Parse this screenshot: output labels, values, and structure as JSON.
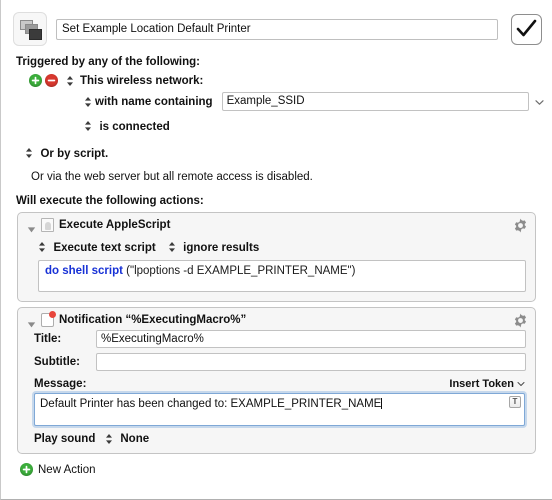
{
  "window": {
    "macro_icon": "macro-stack-icon",
    "title_value": "Set Example Location Default Printer",
    "confirm_icon": "checkmark-icon"
  },
  "triggers": {
    "heading": "Triggered by any of the following:",
    "add_icon": "plus-circle-icon",
    "remove_icon": "minus-circle-icon",
    "trigger_type": "This wireless network:",
    "condition_label": "with name containing",
    "ssid_value": "Example_SSID",
    "ssid_dropdown_icon": "chevron-down-icon",
    "state_label": "is connected",
    "or_by_script": "Or by script.",
    "web_server_note": "Or via the web server but all remote access is disabled."
  },
  "actions": {
    "heading": "Will execute the following actions:",
    "list": [
      {
        "disclosure_icon": "disclosure-triangle-down-icon",
        "icon": "applescript-icon",
        "title": "Execute AppleScript",
        "gear_icon": "gear-icon",
        "option_execute": "Execute text script",
        "option_results": "ignore results",
        "script_keyword": "do shell script",
        "script_rest": " (\"lpoptions -d EXAMPLE_PRINTER_NAME\")"
      },
      {
        "disclosure_icon": "disclosure-triangle-down-icon",
        "icon": "notification-icon",
        "title": "Notification “%ExecutingMacro%”",
        "gear_icon": "gear-icon",
        "title_label": "Title:",
        "title_value": "%ExecutingMacro%",
        "subtitle_label": "Subtitle:",
        "subtitle_value": "",
        "message_label": "Message:",
        "insert_token_label": "Insert Token",
        "insert_token_icon": "chevron-down-icon",
        "message_value": "Default Printer has been changed to: EXAMPLE_PRINTER_NAME",
        "token_button_label": "T",
        "play_sound_label": "Play sound",
        "play_sound_value": "None"
      }
    ]
  },
  "footer": {
    "new_action_icon": "plus-circle-icon",
    "new_action_label": "New Action"
  },
  "colors": {
    "accent_green": "#3cae3c",
    "accent_red": "#d8382f",
    "script_keyword": "#1731d6",
    "focus_ring": "#7fa8d6",
    "panel_bg": "#f6f6f6"
  }
}
